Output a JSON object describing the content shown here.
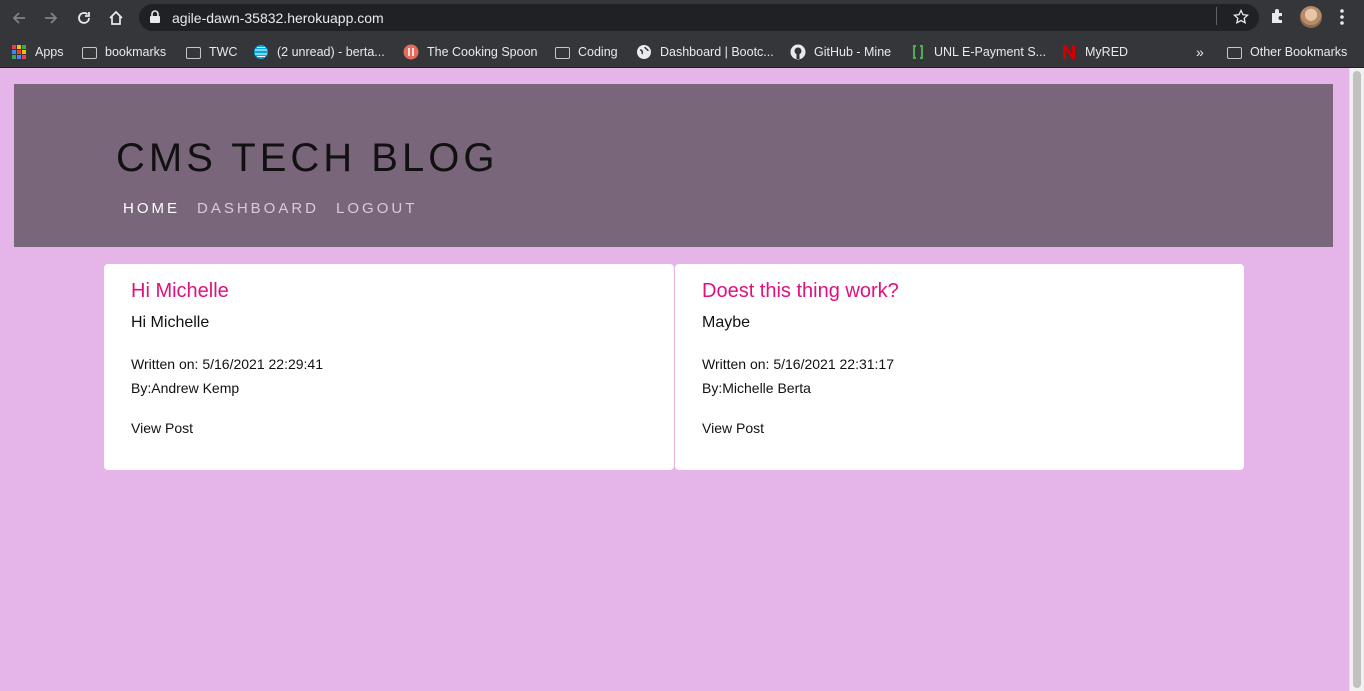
{
  "browser": {
    "url": "agile-dawn-35832.herokuapp.com",
    "bookmarks": [
      {
        "label": "Apps",
        "icon": "apps-grid-icon"
      },
      {
        "label": "bookmarks",
        "icon": "folder-icon"
      },
      {
        "label": "TWC",
        "icon": "folder-icon"
      },
      {
        "label": "(2 unread) - berta...",
        "icon": "att-globe-icon"
      },
      {
        "label": "The Cooking Spoon",
        "icon": "cooking-spoon-icon"
      },
      {
        "label": "Coding",
        "icon": "folder-icon"
      },
      {
        "label": "Dashboard | Bootc...",
        "icon": "globe-icon"
      },
      {
        "label": "GitHub - Mine",
        "icon": "github-icon"
      },
      {
        "label": "UNL E-Payment S...",
        "icon": "bracket-icon"
      },
      {
        "label": "MyRED",
        "icon": "nebraska-n-icon"
      }
    ],
    "overflow_label": "»",
    "other_bookmarks": "Other Bookmarks"
  },
  "site": {
    "title": "CMS TECH BLOG",
    "nav": [
      {
        "label": "HOME",
        "active": true
      },
      {
        "label": "DASHBOARD",
        "active": false
      },
      {
        "label": "LOGOUT",
        "active": false
      }
    ]
  },
  "posts": [
    {
      "title": "Hi Michelle",
      "body": "Hi Michelle",
      "written": "Written on: 5/16/2021 22:29:41",
      "author": "By:Andrew Kemp",
      "link": "View Post"
    },
    {
      "title": "Doest this thing work?",
      "body": "Maybe",
      "written": "Written on: 5/16/2021 22:31:17",
      "author": "By:Michelle Berta",
      "link": "View Post"
    }
  ],
  "colors": {
    "page_bg": "#e5b5ea",
    "header_bg": "#7a667a",
    "post_title": "#e0107f"
  }
}
